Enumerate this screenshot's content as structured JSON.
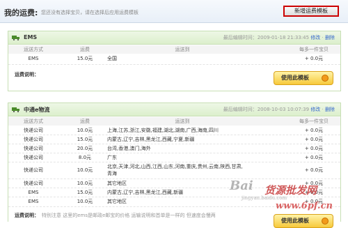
{
  "header": {
    "title": "我的运费:",
    "hint": "您还没有选择宝贝，请在选择后应用运费模板",
    "new_button": "新增运费模板"
  },
  "columns": {
    "method": "运送方式",
    "fee": "运费",
    "dest": "运送到",
    "extra": "每多一件宝贝"
  },
  "templates": [
    {
      "name": "EMS",
      "edit_label": "最后编辑时间：",
      "edit_time": "2009-01-18 21:33:45",
      "modify": "修改",
      "delete": "删除",
      "rows": [
        {
          "method": "EMS",
          "fee": "15.0元",
          "dest": "全国",
          "extra": "+ 0.0元"
        }
      ],
      "note_label": "运费说明：",
      "note_text": "",
      "use_button": "使用此模板"
    },
    {
      "name": "中通e物流",
      "edit_label": "最后编辑时间：",
      "edit_time": "2008-10-03 10:07:39",
      "modify": "修改",
      "delete": "删除",
      "rows": [
        {
          "method": "快递公司",
          "fee": "10.0元",
          "dest": "上海,江苏,浙江,安徽,福建,湖北,湖南,广西,海南,四川",
          "extra": "+ 0.0元"
        },
        {
          "method": "快递公司",
          "fee": "15.0元",
          "dest": "内蒙古,辽宁,吉林,黑龙江,西藏,宁夏,新疆",
          "extra": "+ 0.0元"
        },
        {
          "method": "快递公司",
          "fee": "20.0元",
          "dest": "台湾,香港,澳门,海外",
          "extra": "+ 0.0元"
        },
        {
          "method": "快递公司",
          "fee": "8.0元",
          "dest": "广东",
          "extra": "+ 0.0元"
        },
        {
          "method": "快递公司",
          "fee": "10.0元",
          "dest": "北京,天津,河北,山西,江西,山东,河南,重庆,贵州,云南,陕西,甘肃,",
          "dest2": "青海",
          "extra": "+ 0.0元"
        },
        {
          "method": "快递公司",
          "fee": "10.0元",
          "dest": "其它地区",
          "extra": "+ 0.0元"
        },
        {
          "method": "EMS",
          "fee": "15.0元",
          "dest": "内蒙古,辽宁,吉林,黑龙江,西藏,新疆",
          "extra": "+ 0.0元"
        },
        {
          "method": "EMS",
          "fee": "10.0元",
          "dest": "其它地区",
          "extra": "+ 0.0元"
        }
      ],
      "note_label": "运费说明：",
      "note_text": "特别注意 这里的ems是邮政e邮宝的价格 运输说明和首单是一样的 但速度会慢两",
      "use_button": "使用此模板"
    }
  ],
  "watermark": {
    "bai": "Bai",
    "cn": "货源批发网",
    "url": "www.6pf.cn",
    "jy": "jingyan.baidu.com"
  },
  "colors": {
    "accent_green": "#dcefcc",
    "link": "#3366cc",
    "button_yellow": "#f7c93b",
    "new_button_border": "#cc0000"
  }
}
